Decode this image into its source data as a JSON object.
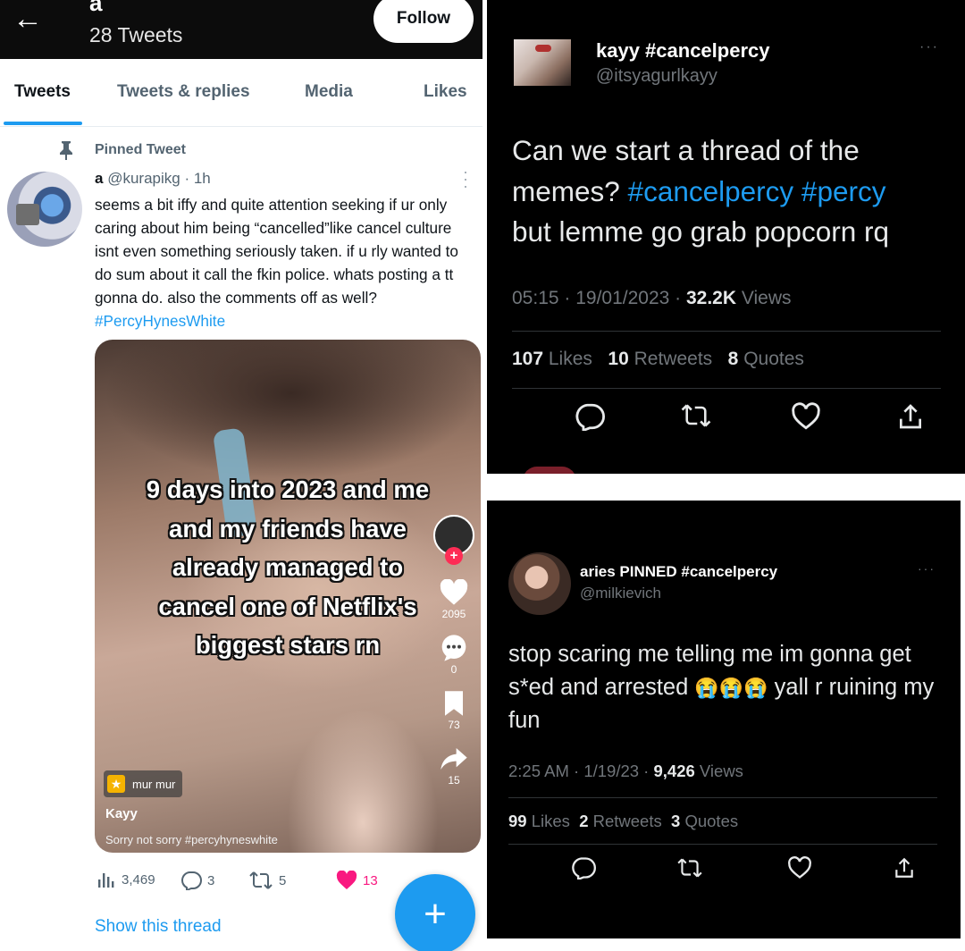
{
  "left": {
    "header": {
      "back_glyph": "←",
      "name": "a",
      "tweet_count": "28 Tweets",
      "follow_label": "Follow"
    },
    "tabs": [
      {
        "label": "Tweets",
        "active": true
      },
      {
        "label": "Tweets & replies",
        "active": false
      },
      {
        "label": "Media",
        "active": false
      },
      {
        "label": "Likes",
        "active": false
      }
    ],
    "pinned_label": "Pinned Tweet",
    "tweet": {
      "name": "a",
      "handle": "@kurapikg",
      "time": "· 1h",
      "text": "seems a bit iffy and quite attention seeking if ur only caring about him being “cancelled”like cancel culture isnt even something seriously taken. if u rly wanted to do sum about it call the fkin police. whats posting a tt gonna do. also the comments off as well? ",
      "hashtag": "#PercyHynesWhite"
    },
    "media": {
      "caption_lines": [
        "9 days into 2023 and me",
        "and my friends have",
        "already managed to",
        "cancel one of Netflix's",
        "biggest stars rn"
      ],
      "likes": "2095",
      "comments": "0",
      "saves": "73",
      "shares": "15",
      "sound_label": "mur mur",
      "username": "Kayy",
      "description": "Sorry not sorry #percyhyneswhite"
    },
    "actions": {
      "views": "3,469",
      "replies": "3",
      "retweets": "5",
      "likes": "13"
    },
    "show_thread": "Show this thread",
    "fab_glyph": "+"
  },
  "right_top": {
    "name": "kayy #cancelpercy",
    "handle": "@itsyagurlkayy",
    "text_start": "Can we start a thread of the memes? ",
    "hashtag1": "#cancelpercy",
    "hashtag2": "#percy",
    "text_end": " but lemme go grab popcorn rq",
    "time": "05:15 · 19/01/2023 · ",
    "views_count": "32.2K",
    "views_label": " Views",
    "likes_count": "107",
    "likes_label": " Likes",
    "retweets_count": "10",
    "retweets_label": " Retweets",
    "quotes_count": "8",
    "quotes_label": " Quotes",
    "more": "···"
  },
  "right_bottom": {
    "name": "aries PINNED #cancelpercy",
    "handle": "@milkievich",
    "text_start": "stop scaring me telling me im gonna get s*ed and arrested ",
    "emojis": "😭😭😭",
    "text_end": " yall r ruining my fun",
    "time": "2:25 AM · 1/19/23 · ",
    "views_count": "9,426",
    "views_label": " Views",
    "likes_count": "99",
    "likes_label": " Likes",
    "retweets_count": "2",
    "retweets_label": " Retweets",
    "quotes_count": "3",
    "quotes_label": " Quotes",
    "more": "···"
  },
  "colors": {
    "twitter_blue": "#1d9bf0",
    "like_pink": "#f91880",
    "dark_bg": "#000000",
    "muted": "#71767b"
  }
}
